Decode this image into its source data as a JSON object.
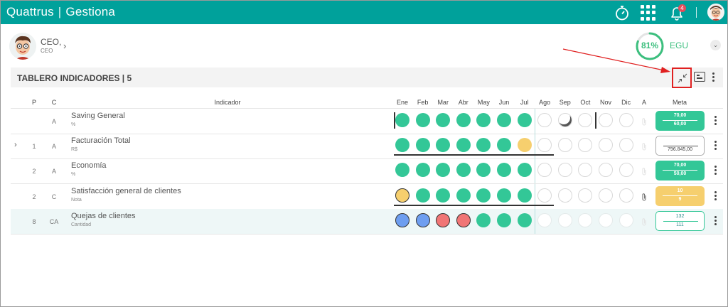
{
  "topbar": {
    "brand_left": "Quattrus",
    "brand_sep": "|",
    "brand_right": "Gestiona",
    "notification_count": "4",
    "icons": [
      "stopwatch-icon",
      "apps-grid-icon",
      "bell-icon",
      "user-avatar"
    ]
  },
  "user": {
    "name": "CEO,",
    "role": "CEO",
    "chevron": "›"
  },
  "score": {
    "value": "81%",
    "percent": 81,
    "label": "EGU",
    "color": "#3cbf7e"
  },
  "panel": {
    "title": "TABLERO INDICADORES | 5",
    "collapse_icon": "chevron-down-icon",
    "tools": [
      "compress-icon",
      "card-view-icon",
      "kebab-menu-icon"
    ]
  },
  "columns": {
    "p": "P",
    "c": "C",
    "indicador": "Indicador",
    "months": [
      "Ene",
      "Feb",
      "Mar",
      "Abr",
      "May",
      "Jun",
      "Jul",
      "Ago",
      "Sep",
      "Oct",
      "Nov",
      "Dic"
    ],
    "a": "A",
    "meta": "Meta"
  },
  "rows": [
    {
      "p": "",
      "c": "A",
      "name": "Saving General",
      "unit": "%",
      "expandable": false,
      "status": [
        "green",
        "green",
        "green",
        "green",
        "green",
        "green",
        "green",
        "empty",
        "moon",
        "empty",
        "empty",
        "empty"
      ],
      "attachment": "faded",
      "meta_top": "70,00",
      "meta_bottom": "60,00",
      "meta_style": "green"
    },
    {
      "p": "1",
      "c": "A",
      "name": "Facturación Total",
      "unit": "R$",
      "expandable": true,
      "expand_label": "›",
      "status": [
        "green",
        "green",
        "green",
        "green",
        "green",
        "green",
        "yellow",
        "empty",
        "empty",
        "empty",
        "empty",
        "empty"
      ],
      "attachment": "faded",
      "meta_top": "",
      "meta_bottom": "796.845,00",
      "meta_style": "white"
    },
    {
      "p": "2",
      "c": "A",
      "name": "Economía",
      "unit": "%",
      "expandable": false,
      "status": [
        "green",
        "green",
        "green",
        "green",
        "green",
        "green",
        "green",
        "empty",
        "empty",
        "empty",
        "empty",
        "empty"
      ],
      "attachment": "faded",
      "meta_top": "70,00",
      "meta_bottom": "50,00",
      "meta_style": "green"
    },
    {
      "p": "2",
      "c": "C",
      "name": "Satisfacción general de clientes",
      "unit": "Nota",
      "expandable": false,
      "status": [
        "yellow-b",
        "green",
        "green",
        "green",
        "green",
        "green",
        "green",
        "empty",
        "empty",
        "empty",
        "empty",
        "empty"
      ],
      "attachment": "active",
      "meta_top": "10",
      "meta_bottom": "9",
      "meta_style": "yellow"
    },
    {
      "p": "8",
      "c": "CA",
      "name": "Quejas de clientes",
      "unit": "Cantidad",
      "expandable": false,
      "status": [
        "blue",
        "blue",
        "red",
        "red",
        "green",
        "green",
        "green",
        "faded",
        "faded",
        "faded",
        "faded",
        "faded"
      ],
      "attachment": "faded",
      "meta_top": "132",
      "meta_bottom": "111",
      "meta_style": "teal",
      "highlighted": true
    }
  ],
  "colors": {
    "topbar": "#00a19b",
    "green": "#33c797",
    "yellow": "#f6cf6e",
    "blue": "#6e9ef0",
    "red": "#f07575",
    "annotation": "#e02020"
  }
}
